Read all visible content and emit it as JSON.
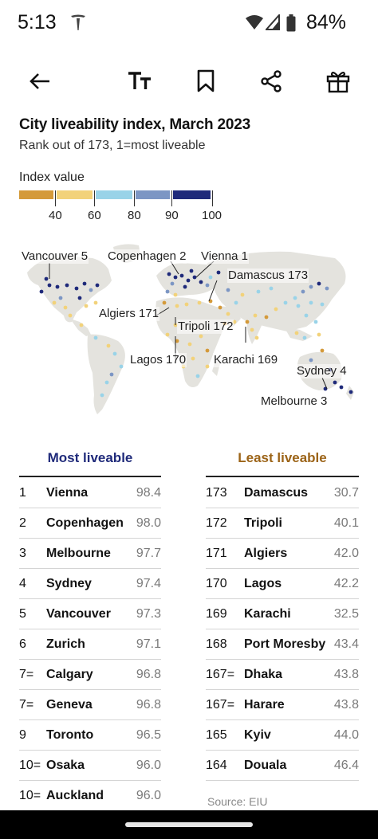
{
  "status": {
    "time": "5:13",
    "battery": "84%"
  },
  "toolbar": [
    "back-arrow-icon",
    "text-size-icon",
    "bookmark-icon",
    "share-icon",
    "gift-icon"
  ],
  "chart": {
    "title": "City liveability index, March 2023",
    "subtitle": "Rank out of 173, 1=most liveable",
    "legend_title": "Index value",
    "legend_ticks": [
      "40",
      "60",
      "80",
      "90",
      "100"
    ],
    "legend_colors": [
      "#d49a3a",
      "#f2d27a",
      "#99d3e8",
      "#7c96c4",
      "#1f2a7a"
    ],
    "map_labels": [
      "Vancouver 5",
      "Copenhagen 2",
      "Vienna 1",
      "Damascus 173",
      "Algiers 171",
      "Tripoli 172",
      "Lagos 170",
      "Karachi 169",
      "Sydney 4",
      "Melbourne 3"
    ]
  },
  "most": {
    "heading": "Most liveable",
    "color": "#1f2a7a",
    "rows": [
      {
        "rank": "1",
        "city": "Vienna",
        "value": "98.4"
      },
      {
        "rank": "2",
        "city": "Copenhagen",
        "value": "98.0"
      },
      {
        "rank": "3",
        "city": "Melbourne",
        "value": "97.7"
      },
      {
        "rank": "4",
        "city": "Sydney",
        "value": "97.4"
      },
      {
        "rank": "5",
        "city": "Vancouver",
        "value": "97.3"
      },
      {
        "rank": "6",
        "city": "Zurich",
        "value": "97.1"
      },
      {
        "rank": "7=",
        "city": "Calgary",
        "value": "96.8"
      },
      {
        "rank": "7=",
        "city": "Geneva",
        "value": "96.8"
      },
      {
        "rank": "9",
        "city": "Toronto",
        "value": "96.5"
      },
      {
        "rank": "10=",
        "city": "Osaka",
        "value": "96.0"
      },
      {
        "rank": "10=",
        "city": "Auckland",
        "value": "96.0"
      }
    ]
  },
  "least": {
    "heading": "Least liveable",
    "color": "#9c6418",
    "rows": [
      {
        "rank": "173",
        "city": "Damascus",
        "value": "30.7"
      },
      {
        "rank": "172",
        "city": "Tripoli",
        "value": "40.1"
      },
      {
        "rank": "171",
        "city": "Algiers",
        "value": "42.0"
      },
      {
        "rank": "170",
        "city": "Lagos",
        "value": "42.2"
      },
      {
        "rank": "169",
        "city": "Karachi",
        "value": "32.5"
      },
      {
        "rank": "168",
        "city": "Port Moresby",
        "value": "43.4"
      },
      {
        "rank": "167=",
        "city": "Dhaka",
        "value": "43.8"
      },
      {
        "rank": "167=",
        "city": "Harare",
        "value": "43.8"
      },
      {
        "rank": "165",
        "city": "Kyiv",
        "value": "44.0"
      },
      {
        "rank": "164",
        "city": "Douala",
        "value": "46.4"
      }
    ]
  },
  "source": "Source: EIU"
}
